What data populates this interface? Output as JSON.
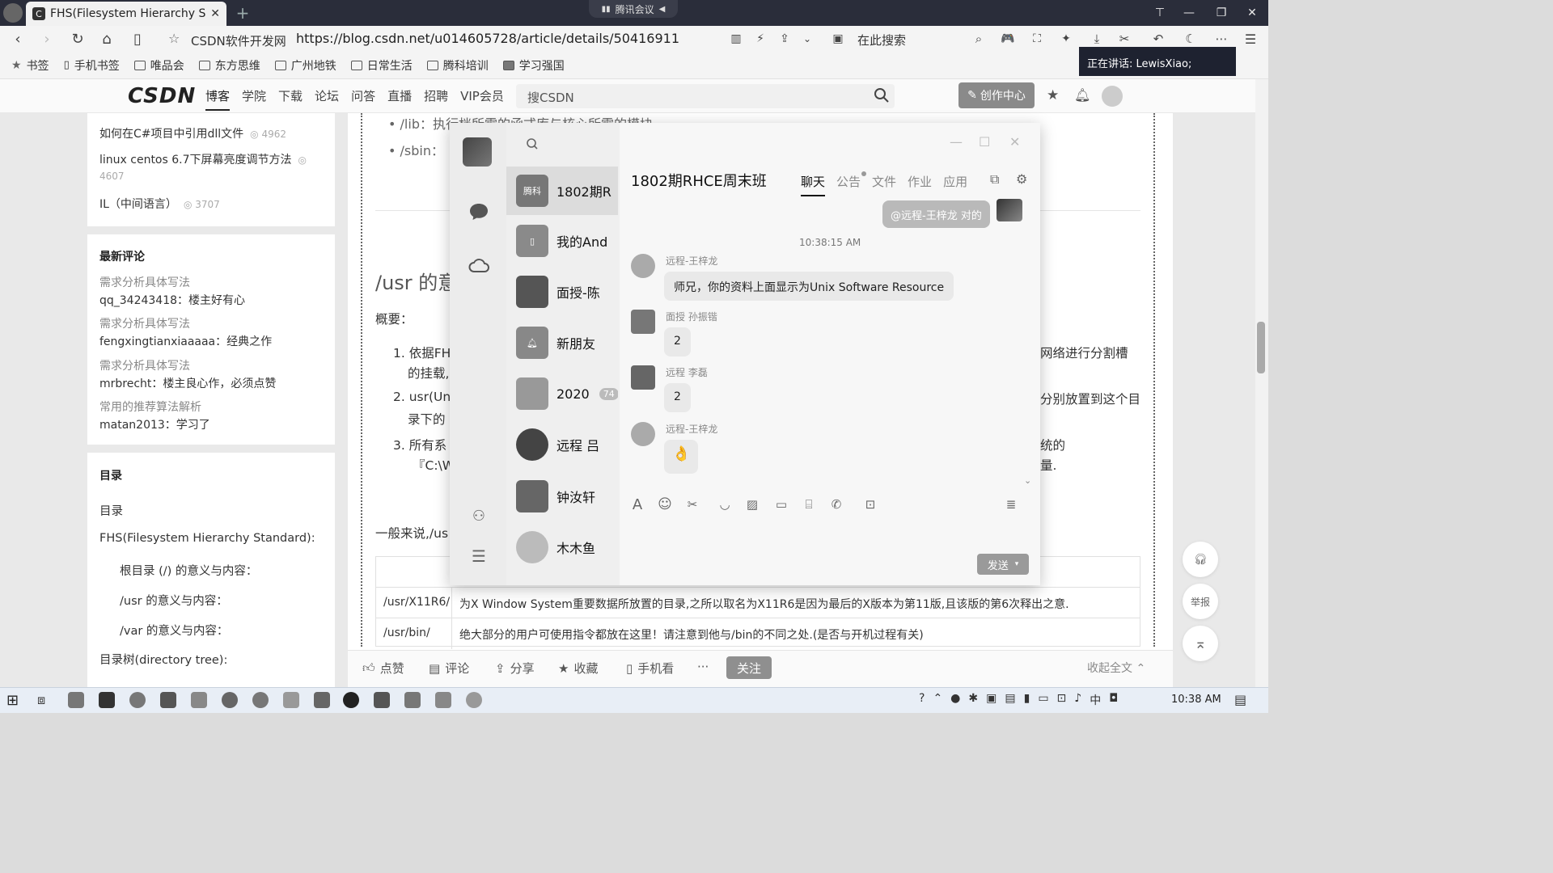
{
  "browser": {
    "tab_title": "FHS(Filesystem Hierarchy Sta",
    "tab_favicon": "C",
    "new_tab": "+",
    "meeting_indicator": "腾讯会议",
    "site_name": "CSDN软件开发网",
    "url": "https://blog.csdn.net/u014605728/article/details/50416911",
    "search_engine": "在此搜索",
    "speaking_banner": "正在讲话: LewisXiao;",
    "bookmarks": [
      "书签",
      "手机书签",
      "唯品会",
      "东方思维",
      "广州地铁",
      "日常生活",
      "腾科培训",
      "学习强国"
    ]
  },
  "csdn": {
    "logo": "CSDN",
    "nav": [
      "博客",
      "学院",
      "下载",
      "论坛",
      "问答",
      "直播",
      "招聘",
      "VIP会员"
    ],
    "search_placeholder": "搜CSDN",
    "create_label": "创作中心"
  },
  "sidebar": {
    "hot": [
      {
        "title": "如何在C#项目中引用dll文件",
        "views": "4962"
      },
      {
        "title": "linux centos 6.7下屏幕亮度调节方法",
        "views": "4607"
      },
      {
        "title": "IL（中间语言）",
        "views": "3707"
      }
    ],
    "comments_title": "最新评论",
    "comments": [
      {
        "article": "需求分析具体写法",
        "text": "qq_34243418：楼主好有心"
      },
      {
        "article": "需求分析具体写法",
        "text": "fengxingtianxiaaaaa：经典之作"
      },
      {
        "article": "需求分析具体写法",
        "text": "mrbrecht：楼主良心作，必须点赞"
      },
      {
        "article": "常用的推荐算法解析",
        "text": "matan2013：学习了"
      }
    ],
    "toc_title": "目录",
    "toc": [
      "目录",
      "FHS(Filesystem Hierarchy Standard):",
      "根目录 (/) 的意义与内容：",
      "/usr 的意义与内容：",
      "/var 的意义与内容：",
      "目录树(directory tree):"
    ]
  },
  "article": {
    "bullet1": "/lib：执行档所需的函式库与核心所需的模块",
    "bullet2": "/sbin：",
    "heading": "/usr 的意",
    "summary": "概要：",
    "p1a": "1. 依据FH",
    "p1b": "的挂载,",
    "p1r": "网络进行分割槽",
    "p2a": "2. usr(Un",
    "p2b": "录下的",
    "p2r": "分别放置到这个目",
    "p3a": "3. 所有系",
    "p3b": "『C:\\W",
    "p3r1": "统的",
    "p3r2": "量.",
    "general": "一般来说,/us",
    "table": [
      {
        "dir": "/usr/X11R6/",
        "desc": "为X Window System重要数据所放置的目录,之所以取名为X11R6是因为最后的X版本为第11版,且该版的第6次释出之意."
      },
      {
        "dir": "/usr/bin/",
        "desc": "绝大部分的用户可使用指令都放在这里！请注意到他与/bin的不同之处.(是否与开机过程有关)"
      }
    ]
  },
  "bottombar": {
    "like": "点赞",
    "comment": "评论",
    "share": "分享",
    "collect": "收藏",
    "mobile": "手机看",
    "more": "···",
    "follow": "关注",
    "collapse": "收起全文"
  },
  "float": {
    "report": "举报"
  },
  "qq": {
    "conversations": [
      {
        "name": "1802期R",
        "avatar_text": "腾科"
      },
      {
        "name": "我的And",
        "avatar_text": ""
      },
      {
        "name": "面授-陈",
        "avatar_text": ""
      },
      {
        "name": "新朋友",
        "avatar_text": ""
      },
      {
        "name": "2020",
        "avatar_text": "",
        "badge": "74"
      },
      {
        "name": "远程 吕",
        "avatar_text": ""
      },
      {
        "name": "钟汝轩",
        "avatar_text": ""
      },
      {
        "name": "木木鱼",
        "avatar_text": ""
      }
    ],
    "chat_title": "1802期RHCE周末班",
    "tabs": [
      "聊天",
      "公告",
      "文件",
      "作业",
      "应用"
    ],
    "my_message": "@远程-王梓龙 对的",
    "time": "10:38:15 AM",
    "messages": [
      {
        "sender": "远程-王梓龙",
        "text": "师兄，你的资料上面显示为Unix Software Resource"
      },
      {
        "sender": "面授 孙振锴",
        "text": "2"
      },
      {
        "sender": "远程 李磊",
        "text": "2"
      },
      {
        "sender": "远程-王梓龙",
        "text": "👌"
      }
    ],
    "send_label": "发送"
  },
  "taskbar": {
    "time": "10:38 AM"
  }
}
